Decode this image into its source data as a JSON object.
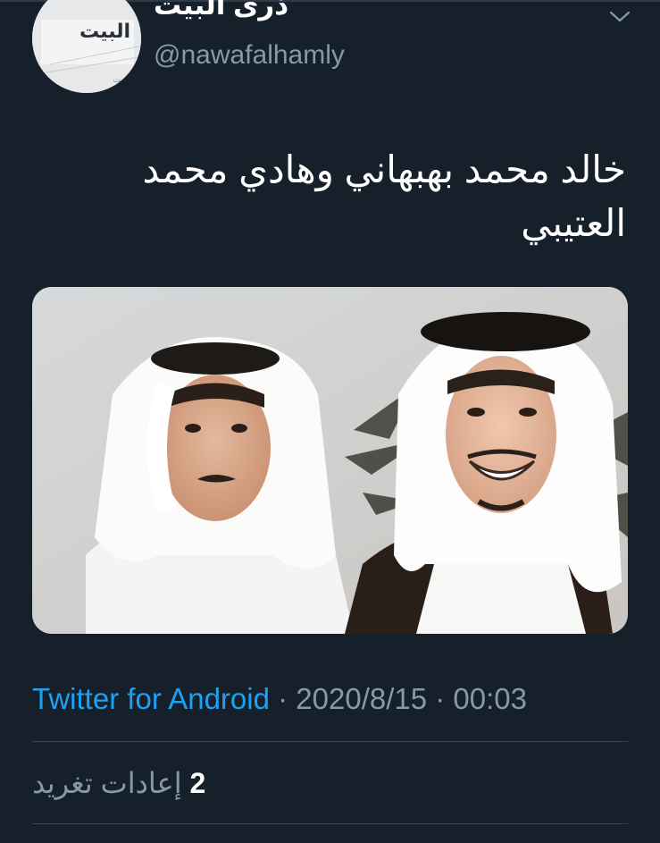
{
  "profile": {
    "display_name": "ذرى البيت",
    "handle": "@nawafalhamly",
    "avatar_text": "البيت",
    "avatar_icon": "avatar-logo"
  },
  "menu": {
    "caret_icon": "chevron-down-icon"
  },
  "tweet": {
    "text": "خالد محمد بهبهاني وهادي محمد العتيبي",
    "media_description_icon": "photo-two-men-kuwaiti-dress"
  },
  "meta": {
    "source": "Twitter for Android",
    "separator": " · ",
    "date": "2020/8/15",
    "time": "00:03"
  },
  "stats": {
    "retweet_count": "2",
    "retweet_label": "إعادات تغريد"
  },
  "colors": {
    "background": "#15202b",
    "accent": "#1da1f2",
    "secondary_text": "#8899a6",
    "divider": "#38444d"
  }
}
